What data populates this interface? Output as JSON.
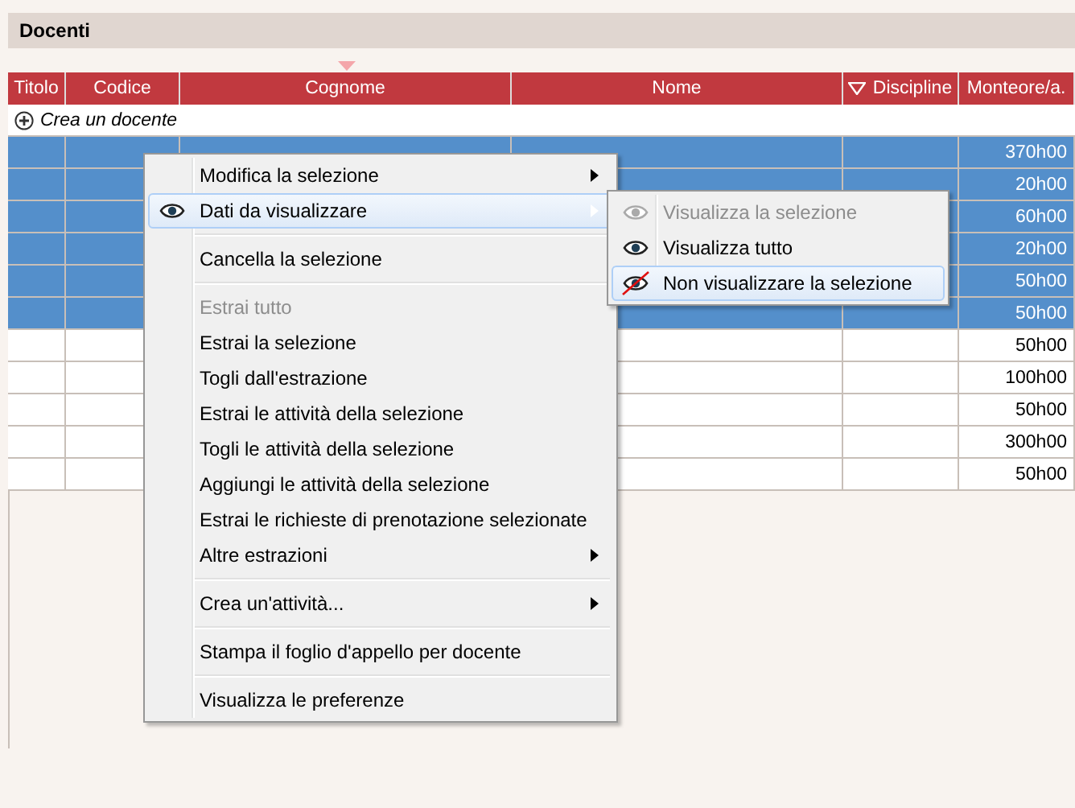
{
  "panel": {
    "title": "Docenti"
  },
  "table": {
    "columns": [
      {
        "label": "Titolo",
        "sorted": false,
        "filter": false
      },
      {
        "label": "Codice",
        "sorted": false,
        "filter": false
      },
      {
        "label": "Cognome",
        "sorted": true,
        "filter": false
      },
      {
        "label": "Nome",
        "sorted": false,
        "filter": false
      },
      {
        "label": "Discipline",
        "sorted": false,
        "filter": true
      },
      {
        "label": "Monteore/a.",
        "sorted": false,
        "filter": false
      }
    ],
    "create_row": "Crea un docente",
    "rows": [
      {
        "selected": true,
        "monteore": "370h00"
      },
      {
        "selected": true,
        "monteore": "20h00"
      },
      {
        "selected": true,
        "monteore": "60h00"
      },
      {
        "selected": true,
        "monteore": "20h00"
      },
      {
        "selected": true,
        "monteore": "50h00"
      },
      {
        "selected": true,
        "monteore": "50h00"
      },
      {
        "selected": false,
        "monteore": "50h00"
      },
      {
        "selected": false,
        "monteore": "100h00"
      },
      {
        "selected": false,
        "monteore": "50h00"
      },
      {
        "selected": false,
        "monteore": "300h00"
      },
      {
        "selected": false,
        "monteore": "50h00"
      }
    ]
  },
  "context_menu": {
    "items": [
      {
        "kind": "item",
        "label": "Modifica la selezione",
        "submenu": true,
        "disabled": false,
        "highlighted": false
      },
      {
        "kind": "eye",
        "label": "Dati da visualizzare",
        "submenu": true,
        "disabled": false,
        "highlighted": true
      },
      {
        "kind": "separator"
      },
      {
        "kind": "item",
        "label": "Cancella la selezione",
        "submenu": false,
        "disabled": false,
        "highlighted": false
      },
      {
        "kind": "separator"
      },
      {
        "kind": "item",
        "label": "Estrai tutto",
        "submenu": false,
        "disabled": true,
        "highlighted": false
      },
      {
        "kind": "item",
        "label": "Estrai la selezione",
        "submenu": false,
        "disabled": false,
        "highlighted": false
      },
      {
        "kind": "item",
        "label": "Togli dall'estrazione",
        "submenu": false,
        "disabled": false,
        "highlighted": false
      },
      {
        "kind": "item",
        "label": "Estrai le attività della selezione",
        "submenu": false,
        "disabled": false,
        "highlighted": false
      },
      {
        "kind": "item",
        "label": "Togli le attività della selezione",
        "submenu": false,
        "disabled": false,
        "highlighted": false
      },
      {
        "kind": "item",
        "label": "Aggiungi le attività della selezione",
        "submenu": false,
        "disabled": false,
        "highlighted": false
      },
      {
        "kind": "item",
        "label": "Estrai le richieste di prenotazione selezionate",
        "submenu": false,
        "disabled": false,
        "highlighted": false
      },
      {
        "kind": "item",
        "label": "Altre estrazioni",
        "submenu": true,
        "disabled": false,
        "highlighted": false
      },
      {
        "kind": "separator"
      },
      {
        "kind": "item",
        "label": "Crea un'attività...",
        "submenu": true,
        "disabled": false,
        "highlighted": false
      },
      {
        "kind": "separator"
      },
      {
        "kind": "item",
        "label": "Stampa il foglio d'appello per docente",
        "submenu": false,
        "disabled": false,
        "highlighted": false
      },
      {
        "kind": "separator"
      },
      {
        "kind": "item",
        "label": "Visualizza le preferenze",
        "submenu": false,
        "disabled": false,
        "highlighted": false
      }
    ]
  },
  "submenu": {
    "items": [
      {
        "kind": "eye",
        "label": "Visualizza la selezione",
        "disabled": true,
        "highlighted": false
      },
      {
        "kind": "eye",
        "label": "Visualizza tutto",
        "disabled": false,
        "highlighted": false
      },
      {
        "kind": "eye-off",
        "label": "Non visualizzare la selezione",
        "disabled": false,
        "highlighted": true
      }
    ]
  }
}
